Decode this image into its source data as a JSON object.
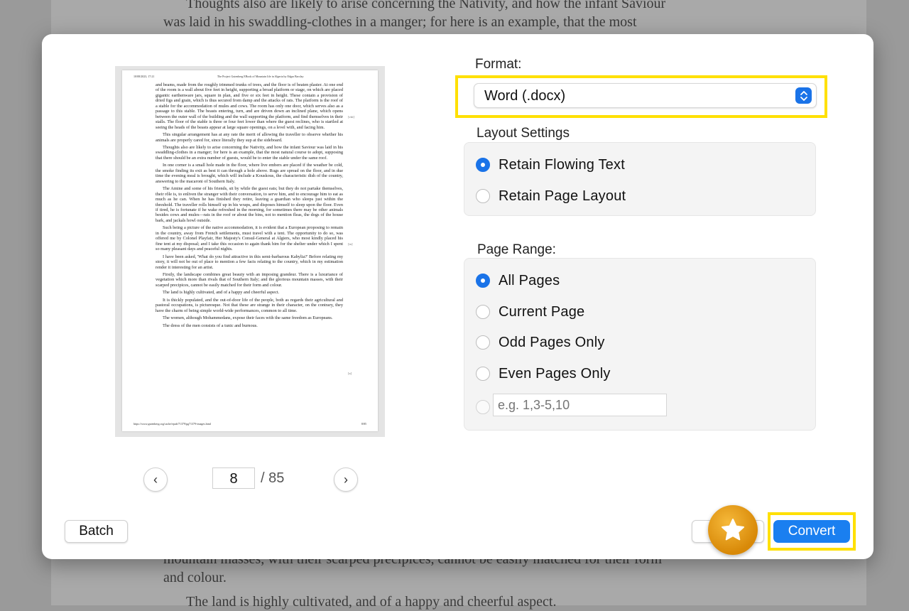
{
  "background": {
    "top_lines": [
      "Thoughts also are likely to arise concerning the Nativity, and how the infant Saviour",
      "was laid in his swaddling-clothes in a manger; for here is an example, that the most"
    ],
    "bottom_lines": [
      "mountain masses, with their scarped precipices, cannot be easily matched for their form",
      "and colour.",
      "The land is highly cultivated, and of a happy and cheerful aspect."
    ]
  },
  "preview": {
    "header_left": "10/08/2023, 17:21",
    "header_center": "The Project Gutenberg EBook of Mountain life in Algeria by Edgar Barclay",
    "footer_left": "https://www.gutenberg.org/cache/epub/71379/pg71379-images.html",
    "footer_right": "8/85",
    "margin_notes": [
      "[viii]",
      "[ix]",
      "[x]"
    ],
    "paragraphs": [
      "and beams, made from the roughly trimmed trunks of trees, and the floor is of beaten plaster. At one end of the room is a wall about five feet in height, supporting a broad platform or stage, on which are placed gigantic earthenware jars, square in plan, and five or six feet in height. These contain a provision of dried figs and grain, which is thus secured from damp and the attacks of rats. The platform is the roof of a stable for the accommodation of mules and cows. The room has only one door, which serves also as a passage to this stable. The beasts entering, turn, and are driven down an inclined plane, which opens between the outer wall of the building and the wall supporting the platform, and find themselves in their stalls. The floor of the stable is three or four feet lower than where the guest reclines, who is startled at seeing the heads of the beasts appear at large square openings, on a level with, and facing him.",
      "This singular arrangement has at any rate the merit of allowing the traveller to observe whether his animals are properly cared for, since literally they sup at the sideboard.",
      "Thoughts also are likely to arise concerning the Nativity, and how the infant Saviour was laid in his swaddling-clothes in a manger; for here is an example, that the most natural course to adopt, supposing that there should be an extra number of guests, would be to enter the stable under the same roof.",
      "In one corner is a small hole made in the floor, where live embers are placed if the weather be cold, the smoke finding its exit as best it can through a hole above. Rugs are spread on the floor, and in due time the evening meal is brought, which will include a Kouskous, the characteristic dish of the country, answering to the macaroni of Southern Italy.",
      "The Amine and some of his friends, sit by while the guest eats; but they do not partake themselves, their rôle is, to enliven the stranger with their conversation, to serve him, and to encourage him to eat as much as he can. When he has finished they retire, leaving a guardian who sleeps just within the threshold. The traveller rolls himself up in his wraps, and disposes himself to sleep upon the floor. Even if tired, he is fortunate if he wake refreshed in the morning, for sometimes there may be other animals besides cows and mules—rats in the roof or about the bins, not to mention fleas, the dogs of the house bark, and jackals howl outside.",
      "Such being a picture of the native accommodation, it is evident that a European proposing to remain in the country, away from French settlements, must travel with a tent. The opportunity to do so, was offered me by Colonel Playfair, Her Majesty's Consul-General at Algiers, who most kindly placed his fine tent at my disposal; and I take this occasion to again thank him for the shelter under which I spent so many pleasant days and peaceful nights.",
      "I have been asked, 'What do you find attractive in this semi-barbarous Kabylia?' Before relating my story, it will not be out of place to mention a few facts relating to the country, which in my estimation render it interesting for an artist.",
      "Firstly, the landscape combines great beauty with an imposing grandeur. There is a luxuriance of vegetation which more than rivals that of Southern Italy; and the glorious mountain masses, with their scarped precipices, cannot be easily matched for their form and colour.",
      "The land is highly cultivated, and of a happy and cheerful aspect.",
      "It is thickly populated, and the out-of-door life of the people, both as regards their agricultural and pastoral occupations, is picturesque. Not that these are strange in their character, on the contrary, they have the charm of being simple world-wide performances, common to all time.",
      "The women, although Mohammedans, expose their faces with the same freedom as Europeans.",
      "The dress of the men consists of a tunic and burnous."
    ]
  },
  "pager": {
    "prev_glyph": "‹",
    "next_glyph": "›",
    "current_page": "8",
    "total": "/ 85"
  },
  "format": {
    "label": "Format:",
    "selected": "Word (.docx)"
  },
  "layout": {
    "label": "Layout Settings",
    "options": [
      "Retain Flowing Text",
      "Retain Page Layout"
    ],
    "selected_index": 0
  },
  "range": {
    "label": "Page Range:",
    "options": [
      "All Pages",
      "Current Page",
      "Odd Pages Only",
      "Even Pages Only"
    ],
    "selected_index": 0,
    "custom_placeholder": "e.g. 1,3-5,10"
  },
  "buttons": {
    "batch": "Batch",
    "convert": "Convert"
  },
  "colors": {
    "accent": "#1a73e8",
    "highlight": "#ffe000",
    "star_badge": "#e19a14"
  }
}
